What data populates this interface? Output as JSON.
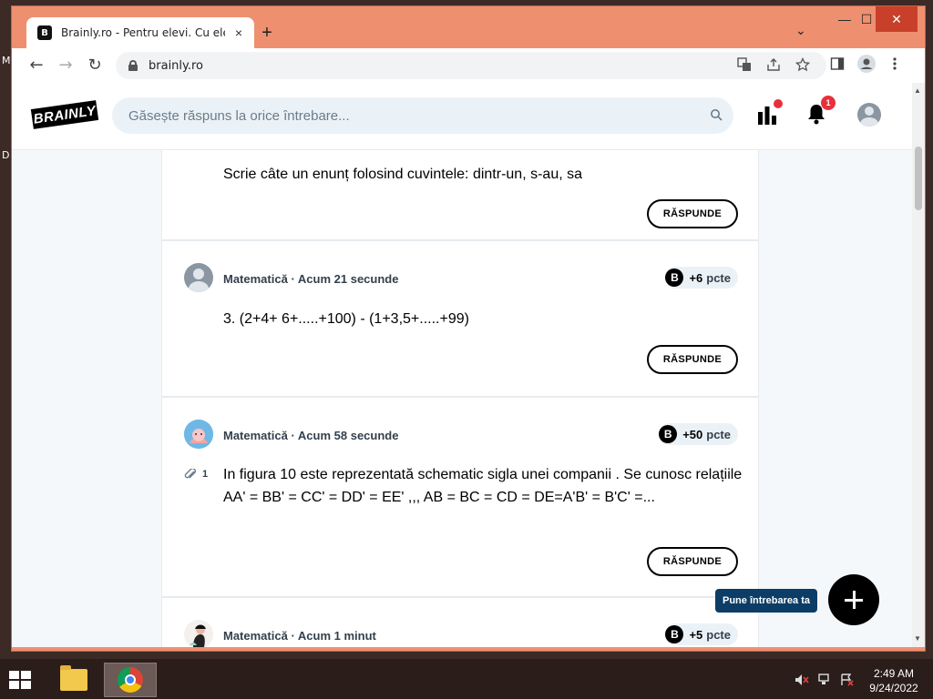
{
  "desktop": {
    "edge_letters": [
      "M",
      "D"
    ]
  },
  "browser": {
    "tab": {
      "favicon": "B",
      "title": "Brainly.ro - Pentru elevi. Cu elevi.",
      "close_icon": "×"
    },
    "new_tab_icon": "+",
    "tab_search_icon": "⌄",
    "window_controls": {
      "minimize": "—",
      "maximize": "☐",
      "close": "✕"
    },
    "nav": {
      "back": "←",
      "forward": "→",
      "reload": "↻"
    },
    "url": "brainly.ro",
    "toolbar_icons": [
      "translate-icon",
      "share-icon",
      "star-icon",
      "sidebar-icon",
      "profile-icon",
      "menu-icon"
    ]
  },
  "site": {
    "logo": "BRAINLY",
    "search_placeholder": "Găsește răspuns la orice întrebare...",
    "notifications_count": "1"
  },
  "questions": [
    {
      "text": "Scrie câte un enunț folosind cuvintele: dintr-un, s-au, sa",
      "reply_label": "RĂSPUNDE"
    },
    {
      "subject": "Matematică",
      "time": "Acum 21 secunde",
      "points": "+6",
      "points_unit": "pcte",
      "text": "3. (2+4+ 6+.....+100) - (1+3,5+.....+99)",
      "reply_label": "RĂSPUNDE"
    },
    {
      "subject": "Matematică",
      "time": "Acum 58 secunde",
      "points": "+50",
      "points_unit": "pcte",
      "attachments": "1",
      "text": "In figura 10 este reprezentată schematic sigla unei companii . Se cunosc relațiile AA' = BB' = CC' = DD' = EE' ,,, AB = BC = CD = DE=A'B' = B'C' =...",
      "reply_label": "RĂSPUNDE"
    },
    {
      "subject": "Matematică",
      "time": "Acum 1 minut",
      "points": "+5",
      "points_unit": "pcte"
    }
  ],
  "ask_button_label": "Pune întrebarea ta",
  "taskbar": {
    "time": "2:49 AM",
    "date": "9/24/2022"
  }
}
